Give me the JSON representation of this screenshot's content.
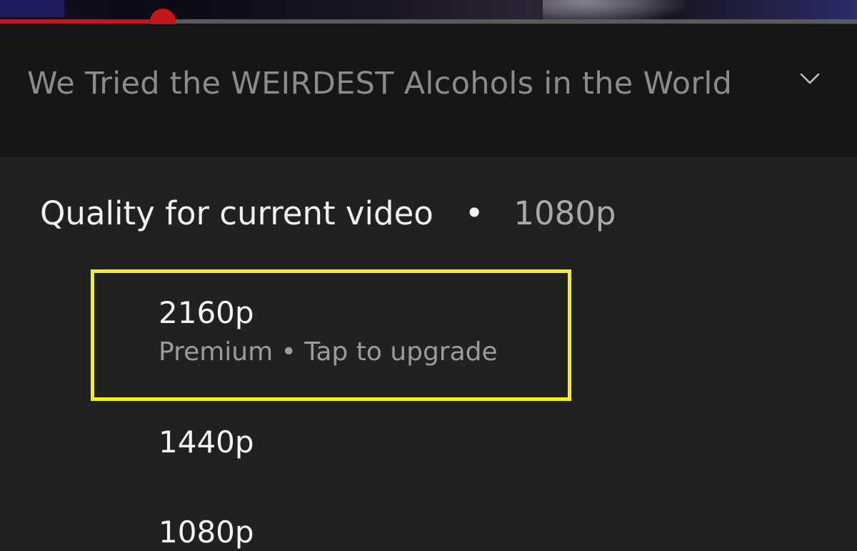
{
  "player": {
    "progress_percent": 19
  },
  "title_bar": {
    "video_title": "We Tried the WEIRDEST Alcohols in the World",
    "collapse_icon": "chevron-down-icon"
  },
  "quality_panel": {
    "header_label": "Quality for current video",
    "separator": "•",
    "current_quality": "1080p",
    "options": [
      {
        "label": "2160p",
        "sub": "Premium • Tap to upgrade"
      },
      {
        "label": "1440p"
      },
      {
        "label": "1080p"
      }
    ]
  },
  "colors": {
    "progress_red": "#c4161c",
    "highlight_yellow": "#f5ef1b",
    "panel_bg": "#212121",
    "title_bg": "#161616"
  }
}
